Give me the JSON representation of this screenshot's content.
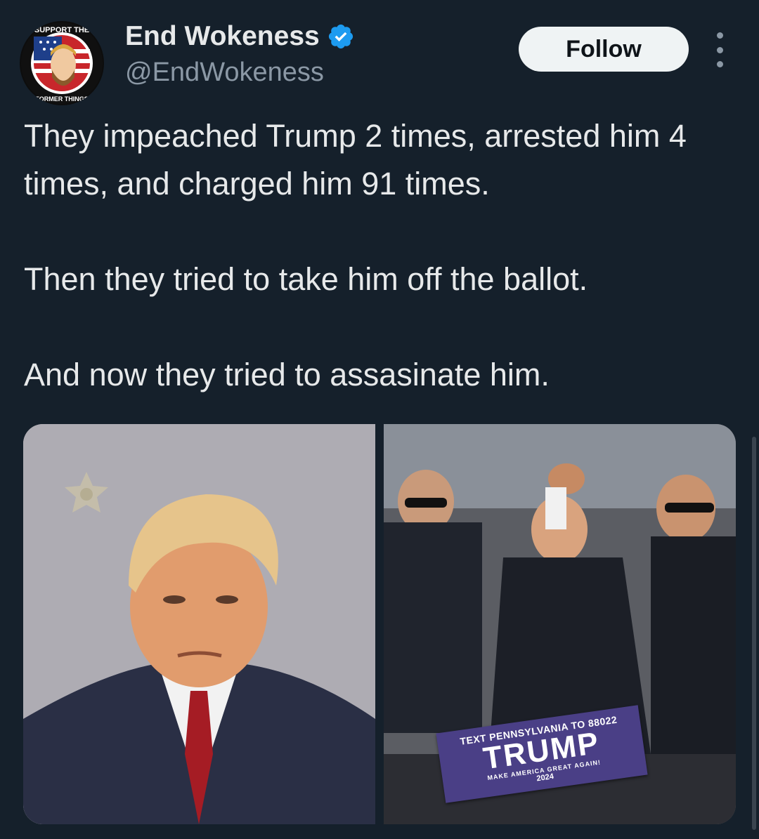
{
  "author": {
    "display_name": "End Wokeness",
    "handle": "@EndWokeness",
    "verified": true,
    "avatar": {
      "top_text": "SUPPORT THE",
      "bottom_text": "FORMER THINGS"
    }
  },
  "actions": {
    "follow_label": "Follow",
    "more_icon": "more-vertical-icon"
  },
  "tweet": {
    "paragraphs": [
      "They impeached Trump 2 times, arrested him 4 times, and charged him 91 times.",
      "Then they tried to take him off the ballot.",
      "And now they tried to assasinate him."
    ]
  },
  "media": {
    "photo_right_sign": {
      "line1": "TEXT PENNSYLVANIA TO 88022",
      "line2": "TRUMP",
      "line3": "MAKE AMERICA GREAT AGAIN!",
      "line4": "2024"
    }
  },
  "colors": {
    "background": "#15202b",
    "text": "#e7e9ea",
    "secondary": "#8b98a5",
    "verified": "#1d9bf0",
    "follow_bg": "#eff3f4"
  }
}
